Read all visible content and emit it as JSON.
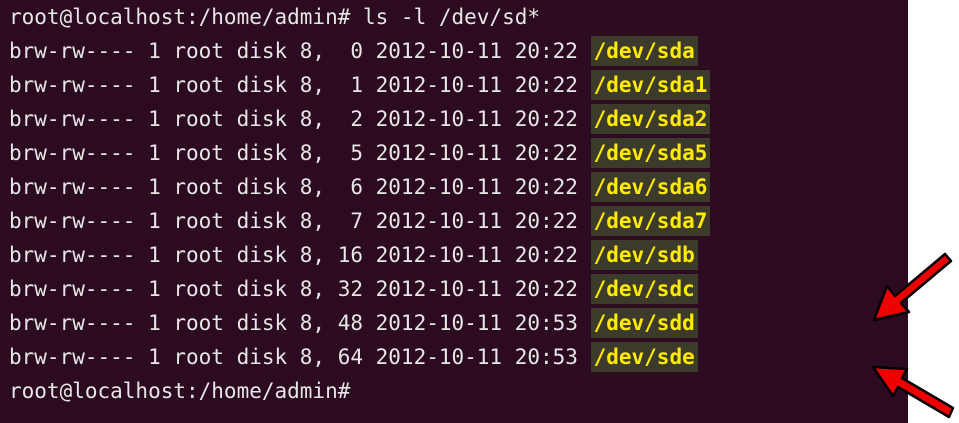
{
  "terminal": {
    "command_prompt": "root@localhost:/home/admin# ls -l /dev/sd*",
    "entries": [
      {
        "perms": "brw-rw----",
        "links": "1",
        "owner": "root",
        "group": "disk",
        "major": "8,",
        "minor": " 0",
        "date": "2012-10-11",
        "time": "20:22",
        "name": "/dev/sda"
      },
      {
        "perms": "brw-rw----",
        "links": "1",
        "owner": "root",
        "group": "disk",
        "major": "8,",
        "minor": " 1",
        "date": "2012-10-11",
        "time": "20:22",
        "name": "/dev/sda1"
      },
      {
        "perms": "brw-rw----",
        "links": "1",
        "owner": "root",
        "group": "disk",
        "major": "8,",
        "minor": " 2",
        "date": "2012-10-11",
        "time": "20:22",
        "name": "/dev/sda2"
      },
      {
        "perms": "brw-rw----",
        "links": "1",
        "owner": "root",
        "group": "disk",
        "major": "8,",
        "minor": " 5",
        "date": "2012-10-11",
        "time": "20:22",
        "name": "/dev/sda5"
      },
      {
        "perms": "brw-rw----",
        "links": "1",
        "owner": "root",
        "group": "disk",
        "major": "8,",
        "minor": " 6",
        "date": "2012-10-11",
        "time": "20:22",
        "name": "/dev/sda6"
      },
      {
        "perms": "brw-rw----",
        "links": "1",
        "owner": "root",
        "group": "disk",
        "major": "8,",
        "minor": " 7",
        "date": "2012-10-11",
        "time": "20:22",
        "name": "/dev/sda7"
      },
      {
        "perms": "brw-rw----",
        "links": "1",
        "owner": "root",
        "group": "disk",
        "major": "8,",
        "minor": "16",
        "date": "2012-10-11",
        "time": "20:22",
        "name": "/dev/sdb"
      },
      {
        "perms": "brw-rw----",
        "links": "1",
        "owner": "root",
        "group": "disk",
        "major": "8,",
        "minor": "32",
        "date": "2012-10-11",
        "time": "20:22",
        "name": "/dev/sdc"
      },
      {
        "perms": "brw-rw----",
        "links": "1",
        "owner": "root",
        "group": "disk",
        "major": "8,",
        "minor": "48",
        "date": "2012-10-11",
        "time": "20:53",
        "name": "/dev/sdd"
      },
      {
        "perms": "brw-rw----",
        "links": "1",
        "owner": "root",
        "group": "disk",
        "major": "8,",
        "minor": "64",
        "date": "2012-10-11",
        "time": "20:53",
        "name": "/dev/sde"
      }
    ],
    "final_prompt": "root@localhost:/home/admin#"
  },
  "colors": {
    "background": "#2c0a1f",
    "text": "#e6e6e6",
    "device_highlight": "#ffea00",
    "arrow": "#ee0000"
  },
  "annotations": {
    "arrow_icons": [
      "red-arrow-icon",
      "red-arrow-icon"
    ]
  }
}
